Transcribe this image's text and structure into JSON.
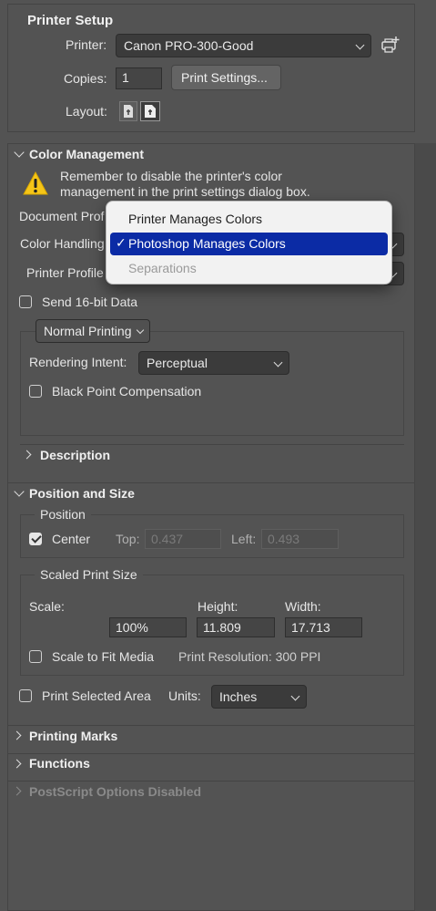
{
  "printer_setup": {
    "title": "Printer Setup",
    "printer_label": "Printer:",
    "printer_value": "Canon PRO-300-Good",
    "copies_label": "Copies:",
    "copies_value": "1",
    "print_settings_button": "Print Settings...",
    "layout_label": "Layout:"
  },
  "color_management": {
    "title": "Color Management",
    "warning_line1": "Remember to disable the printer's color",
    "warning_line2": "management in the print settings dialog box.",
    "document_profile_label": "Document Prof",
    "color_handling_label": "Color Handling",
    "printer_profile_label": "Printer Profile",
    "send16_label": "Send 16-bit Data",
    "normal_printing": "Normal Printing",
    "rendering_intent_label": "Rendering Intent:",
    "rendering_intent_value": "Perceptual",
    "black_point_label": "Black Point Compensation",
    "description_label": "Description"
  },
  "color_handling_menu": {
    "items": [
      "Printer Manages Colors",
      "Photoshop Manages Colors",
      "Separations"
    ],
    "selected": "Photoshop Manages Colors",
    "checkmark": "✓"
  },
  "position_size": {
    "title": "Position and Size",
    "position_label": "Position",
    "center_label": "Center",
    "top_label": "Top:",
    "top_value": "0.437",
    "left_label": "Left:",
    "left_value": "0.493",
    "scaled_label": "Scaled Print Size",
    "scale_label": "Scale:",
    "height_label": "Height:",
    "width_label": "Width:",
    "scale_value": "100%",
    "height_value": "11.809",
    "width_value": "17.713",
    "fit_media_label": "Scale to Fit Media",
    "print_resolution": "Print Resolution: 300 PPI",
    "print_selected_label": "Print Selected Area",
    "units_label": "Units:",
    "units_value": "Inches"
  },
  "sections": {
    "printing_marks": "Printing Marks",
    "functions": "Functions",
    "postscript": "PostScript Options Disabled"
  },
  "colors": {
    "panel_bg": "#535353",
    "menu_selection": "#0b2ba5",
    "warning_yellow": "#f5c518"
  }
}
